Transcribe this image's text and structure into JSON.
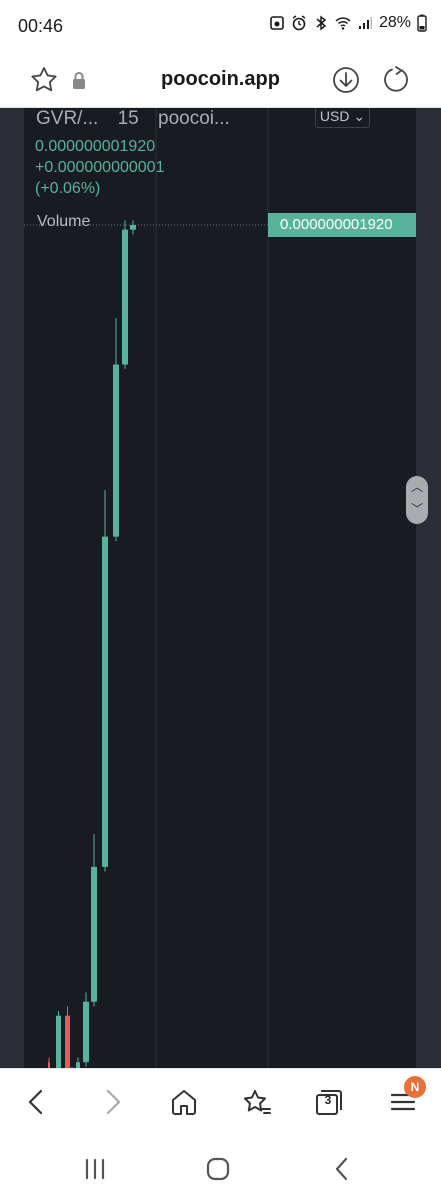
{
  "status_bar": {
    "time": "00:46",
    "battery": "28%",
    "icons": [
      "photo-icon",
      "alarm-icon",
      "bluetooth-icon",
      "wifi-icon",
      "signal-icon"
    ]
  },
  "browser": {
    "url": "poocoin.app",
    "tab_count": "3",
    "menu_badge": "N"
  },
  "chart": {
    "pair": "GVR/...",
    "interval": "15",
    "source": "poocoi...",
    "currency": "USD",
    "price": "0.000000001920",
    "change": "+0.000000000001",
    "change_pct": "(+0.06%)",
    "volume_label": "Volume",
    "price_tag": "0.000000001920",
    "colors": {
      "up": "#59b39b",
      "down": "#e05e5e",
      "bg": "#181b22"
    }
  },
  "chart_data": {
    "type": "candlestick",
    "title": "",
    "candles": [
      {
        "open": 1e-10,
        "close": 1.2e-10,
        "high": 1.3e-10,
        "low": 9e-11,
        "dir": "down"
      },
      {
        "open": 5e-11,
        "close": 2.2e-10,
        "high": 2.3e-10,
        "low": 5e-11,
        "dir": "up"
      },
      {
        "open": 2.2e-10,
        "close": 5e-11,
        "high": 2.4e-10,
        "low": 4e-11,
        "dir": "down"
      },
      {
        "open": 6e-11,
        "close": 8e-11,
        "high": 1.1e-10,
        "low": 5e-11,
        "dir": "up"
      },
      {
        "open": 8e-11,
        "close": 1.2e-10,
        "high": 1.3e-10,
        "low": 7e-11,
        "dir": "up"
      },
      {
        "open": 1.2e-10,
        "close": 2.5e-10,
        "high": 2.7e-10,
        "low": 1.1e-10,
        "dir": "up"
      },
      {
        "open": 2.5e-10,
        "close": 5.4e-10,
        "high": 6.1e-10,
        "low": 2.4e-10,
        "dir": "up"
      },
      {
        "open": 5.4e-10,
        "close": 1.25e-09,
        "high": 1.35e-09,
        "low": 5.3e-10,
        "dir": "up"
      },
      {
        "open": 1.25e-09,
        "close": 1.62e-09,
        "high": 1.72e-09,
        "low": 1.24e-09,
        "dir": "up"
      },
      {
        "open": 1.62e-09,
        "close": 1.91e-09,
        "high": 1.93e-09,
        "low": 1.61e-09,
        "dir": "up"
      },
      {
        "open": 1.91e-09,
        "close": 1.92e-09,
        "high": 1.93e-09,
        "low": 1.9e-09,
        "dir": "up"
      }
    ],
    "last_price": 1.92e-09
  }
}
